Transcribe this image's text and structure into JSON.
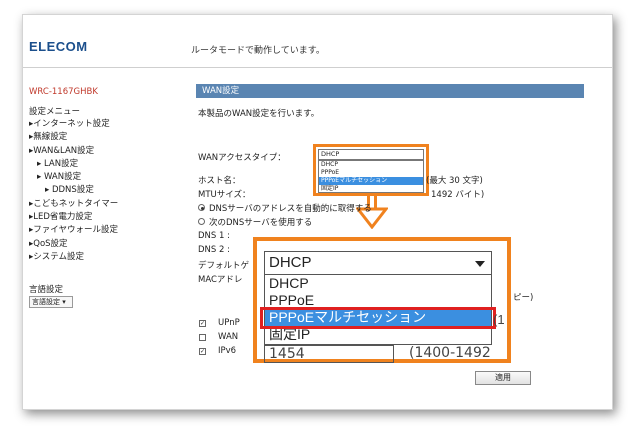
{
  "header": {
    "logo": "ELECOM",
    "mode_text": "ルータモードで動作しています。"
  },
  "sidebar": {
    "model": "WRC-1167GHBK",
    "menu_title": "設定メニュー",
    "items": [
      {
        "label": "▸インターネット設定",
        "level": 1
      },
      {
        "label": "▸無線設定",
        "level": 1
      },
      {
        "label": "▸WAN&LAN設定",
        "level": 1
      },
      {
        "label": "▸ LAN設定",
        "level": 2
      },
      {
        "label": "▸ WAN設定",
        "level": 2
      },
      {
        "label": "▸ DDNS設定",
        "level": 3
      },
      {
        "label": "▸こどもネットタイマー",
        "level": 1
      },
      {
        "label": "▸LED省電力設定",
        "level": 1
      },
      {
        "label": "▸ファイヤウォール設定",
        "level": 1
      },
      {
        "label": "▸QoS設定",
        "level": 1
      },
      {
        "label": "▸システム設定",
        "level": 1
      }
    ],
    "language_label": "言語設定",
    "language_select": "言語設定 ▾"
  },
  "main": {
    "title": "WAN設定",
    "description": "本製品のWAN設定を行います。",
    "wan_access_type_label": "WANアクセスタイプ：",
    "hostname_label": "ホスト名：",
    "hostname_hint": "(最大 30 文字)",
    "mtu_label": "MTUサイズ：",
    "mtu_hint": "1492 バイト)",
    "dns_auto": "DNSサーバのアドレスを自動的に取得する",
    "dns_manual": "次のDNSサーバを使用する",
    "dns1_label": "DNS 1 :",
    "dns2_label": "DNS 2 :",
    "default_gw_label": "デフォルトゲ",
    "mac_label": "MACアドレ",
    "mac_suffix": "ピー)",
    "upnp_label": "UPnP",
    "wan_label": "WAN",
    "ipv6_label": "IPv6",
    "apply_button": "適用",
    "small_dropdown": {
      "selected": "DHCP",
      "options": [
        "DHCP",
        "PPPoE",
        "PPPoEマルチセッション",
        "固定IP"
      ],
      "highlighted": "PPPoEマルチセッション"
    },
    "zoom": {
      "selected": "DHCP",
      "options": [
        "DHCP",
        "PPPoE",
        "PPPoEマルチセッション",
        "固定IP"
      ],
      "highlighted": "PPPoEマルチセッション",
      "mtu_value": "1454",
      "mtu_range": "(1400-1492",
      "edge_char": "(1"
    }
  },
  "colors": {
    "accent_orange": "#f0821e",
    "highlight_red": "#e02020",
    "selection_blue": "#3b8fe0",
    "title_bar": "#5a85b2",
    "logo": "#1b4f8c",
    "model_text": "#c0392b"
  }
}
